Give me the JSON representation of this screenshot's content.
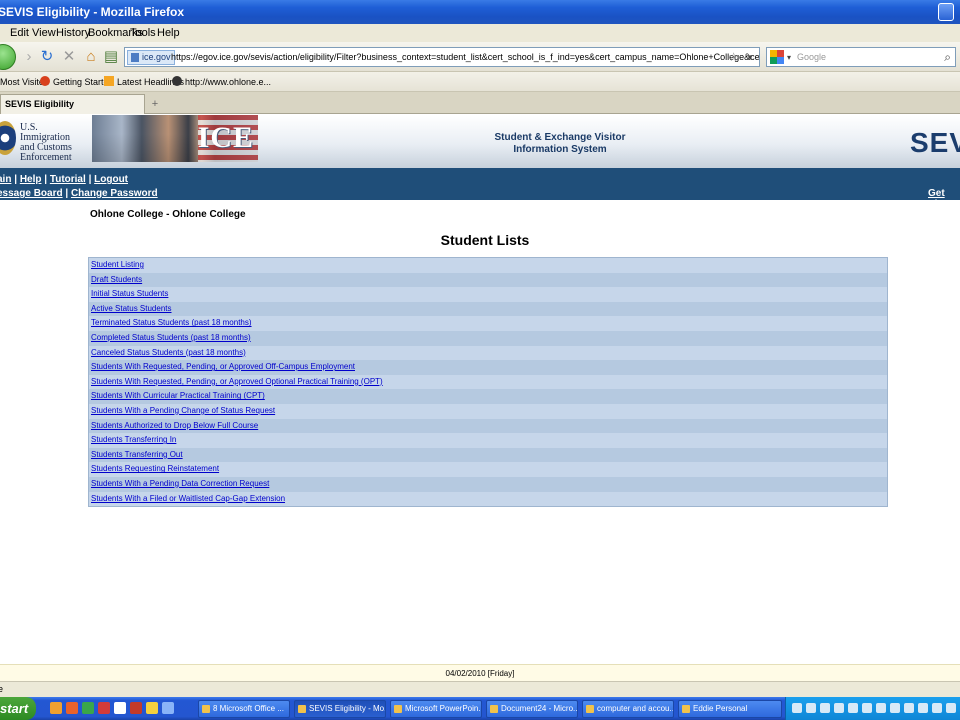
{
  "window": {
    "title": "SEVIS Eligibility - Mozilla Firefox"
  },
  "menu": [
    "Edit",
    "View",
    "History",
    "Bookmarks",
    "Tools",
    "Help"
  ],
  "address": {
    "site_badge": "ice.gov",
    "url": "https://egov.ice.gov/sevis/action/eligibility/Filter?business_context=student_list&cert_school_is_f_ind=yes&cert_campus_name=Ohlone+College&cert_school_is_m_ind=no&cert_is_pu"
  },
  "search": {
    "placeholder": "Google"
  },
  "bookmarks": [
    "Most Visited",
    "Getting Started",
    "Latest Headlines",
    "http://www.ohlone.e..."
  ],
  "tab": {
    "label": "SEVIS Eligibility",
    "new_tab": "+"
  },
  "banner": {
    "agency_lines": [
      "U.S. Immigration",
      "and Customs",
      "Enforcement"
    ],
    "logo_text": "ICE",
    "system_line1": "Student & Exchange Visitor",
    "system_line2": "Information System",
    "sevis_short": "SEV"
  },
  "nav": {
    "main": "ain",
    "help": "Help",
    "tutorial": "Tutorial",
    "logout": "Logout",
    "message_board": "essage Board",
    "change_password": "Change Password",
    "get_plugins": "Get Plu"
  },
  "page": {
    "school": "Ohlone College - Ohlone College",
    "title": "Student Lists"
  },
  "student_lists": [
    "Student Listing",
    "Draft Students",
    "Initial Status Students",
    "Active Status Students",
    "Terminated Status Students (past 18 months)",
    "Completed Status Students (past 18 months)",
    "Canceled Status Students (past 18 months)",
    "Students With Requested, Pending, or Approved Off-Campus Employment",
    "Students With Requested, Pending, or Approved Optional Practical Training (OPT)",
    "Students With Curricular Practical Training (CPT)",
    "Students With a Pending Change of Status Request",
    "Students Authorized to Drop Below Full Course",
    "Students Transferring In",
    "Students Transferring Out",
    "Students Requesting Reinstatement",
    "Students With a Pending Data Correction Request",
    "Students With a Filed or Waitlisted Cap-Gap Extension"
  ],
  "footer": {
    "date": "04/02/2010 [Friday]"
  },
  "status": {
    "text": "e"
  },
  "taskbar": {
    "start": "start",
    "buttons": [
      "8 Microsoft Office ...",
      "SEVIS Eligibility - Mo...",
      "Microsoft PowerPoin...",
      "Document24 - Micro...",
      "computer and accou...",
      "Eddie Personal"
    ]
  }
}
